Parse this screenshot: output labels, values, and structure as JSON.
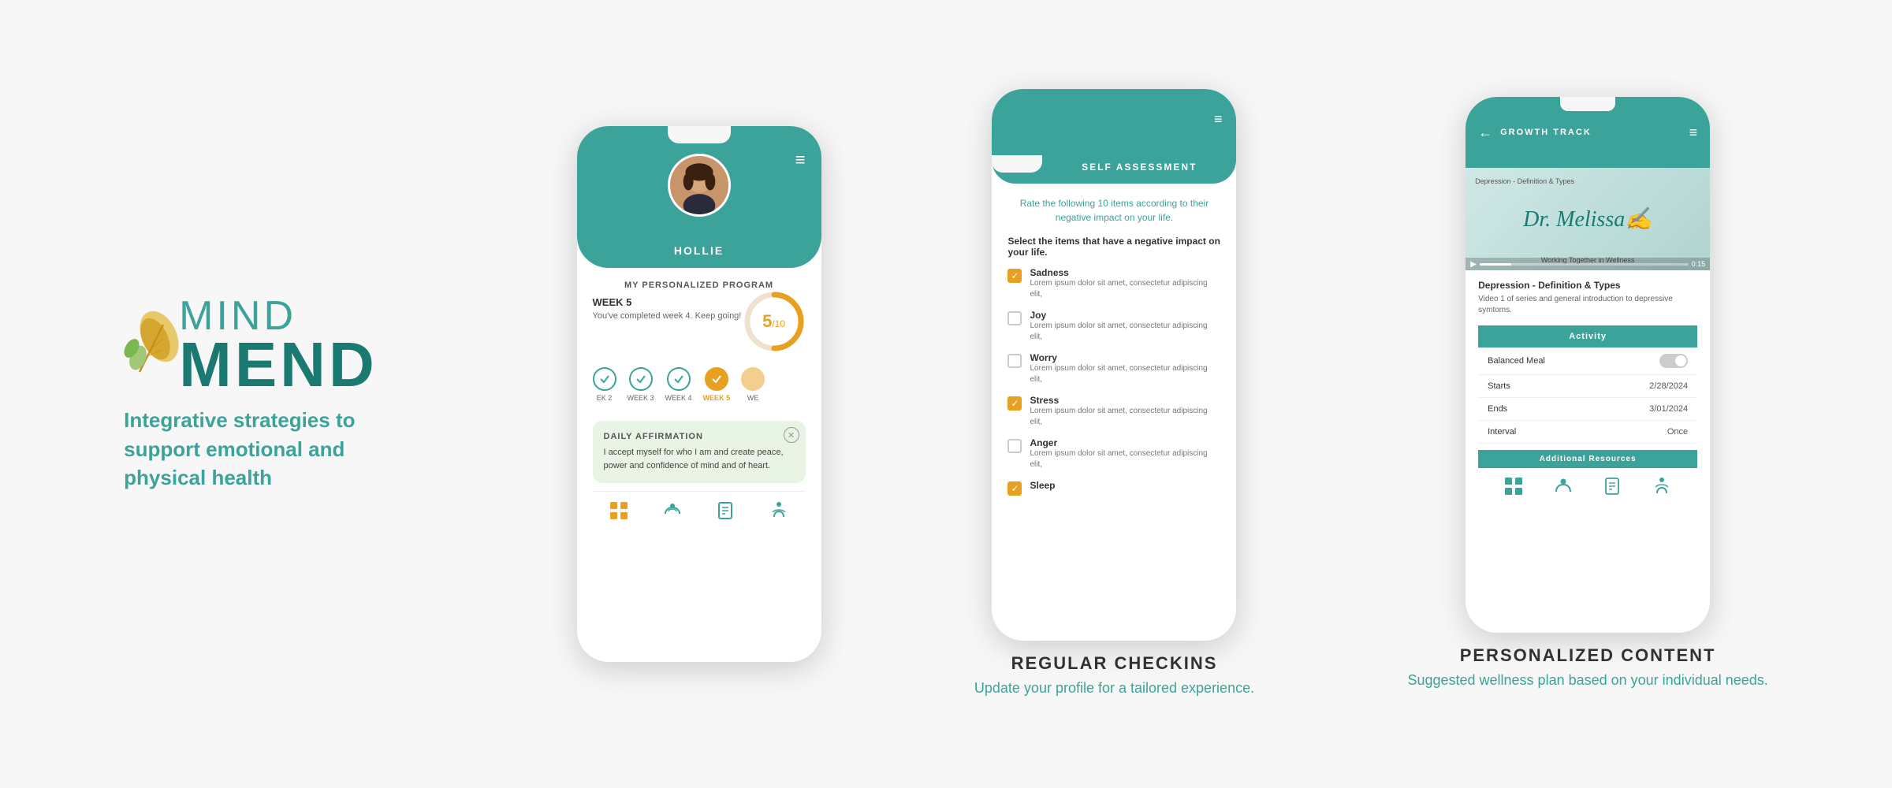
{
  "app": {
    "logo_mind": "MIND",
    "logo_mend": "MEND",
    "tagline": "Integrative strategies to support emotional and physical health"
  },
  "phone1": {
    "notch_visible": true,
    "user_name": "HOLLIE",
    "program_title": "MY PERSONALIZED PROGRAM",
    "week_label": "WEEK 5",
    "week_sub": "You've completed week 4. Keep going!",
    "progress_current": 5,
    "progress_total": 10,
    "weeks": [
      {
        "label": "EK 2",
        "state": "completed"
      },
      {
        "label": "WEEK 3",
        "state": "completed"
      },
      {
        "label": "WEEK 4",
        "state": "completed"
      },
      {
        "label": "WEEK 5",
        "state": "active"
      },
      {
        "label": "WE",
        "state": "upcoming"
      }
    ],
    "affirmation_title": "DAILY AFFIRMATION",
    "affirmation_text": "I accept myself for who I am and create peace, power and confidence of mind and of heart.",
    "nav_icons": [
      "grid",
      "hands",
      "journal",
      "meditation"
    ]
  },
  "phone2": {
    "screen_title": "SELF ASSESSMENT",
    "prompt": "Rate the following 10 items according to their negative impact on your life.",
    "instruction": "Select the items that have a negative impact on your life.",
    "items": [
      {
        "name": "Sadness",
        "desc": "Lorem ipsum dolor sit amet, consectetur adipiscing elit,",
        "checked": true
      },
      {
        "name": "Joy",
        "desc": "Lorem ipsum dolor sit amet, consectetur adipiscing elit,",
        "checked": false
      },
      {
        "name": "Worry",
        "desc": "Lorem ipsum dolor sit amet, consectetur adipiscing elit,",
        "checked": false
      },
      {
        "name": "Stress",
        "desc": "Lorem ipsum dolor sit amet, consectetur adipiscing elit,",
        "checked": true
      },
      {
        "name": "Anger",
        "desc": "Lorem ipsum dolor sit amet, consectetur adipiscing elit,",
        "checked": false
      },
      {
        "name": "Sleep",
        "desc": "",
        "checked": true
      }
    ]
  },
  "phone2_caption": {
    "title": "REGULAR CHECKINS",
    "subtitle": "Update your profile for a tailored experience."
  },
  "phone3": {
    "screen_title": "GROWTH TRACK",
    "video_label": "Depression - Definition & Types",
    "video_subtitle": "Working Together in Wellness",
    "video_series": "Video 1 of series and general introduction to depressive symtoms.",
    "signature": "Dr. Melissa",
    "activity_section": "Activity",
    "activity_item": "Balanced Meal",
    "toggle_state": "off",
    "rows": [
      {
        "label": "Starts",
        "value": "2/28/2024"
      },
      {
        "label": "Ends",
        "value": "3/01/2024"
      },
      {
        "label": "Interval",
        "value": "Once"
      }
    ],
    "additional_resources_label": "Additional Resources"
  },
  "phone3_caption": {
    "title": "PERSONALIZED CONTENT",
    "subtitle": "Suggested wellness plan based on your individual needs."
  }
}
